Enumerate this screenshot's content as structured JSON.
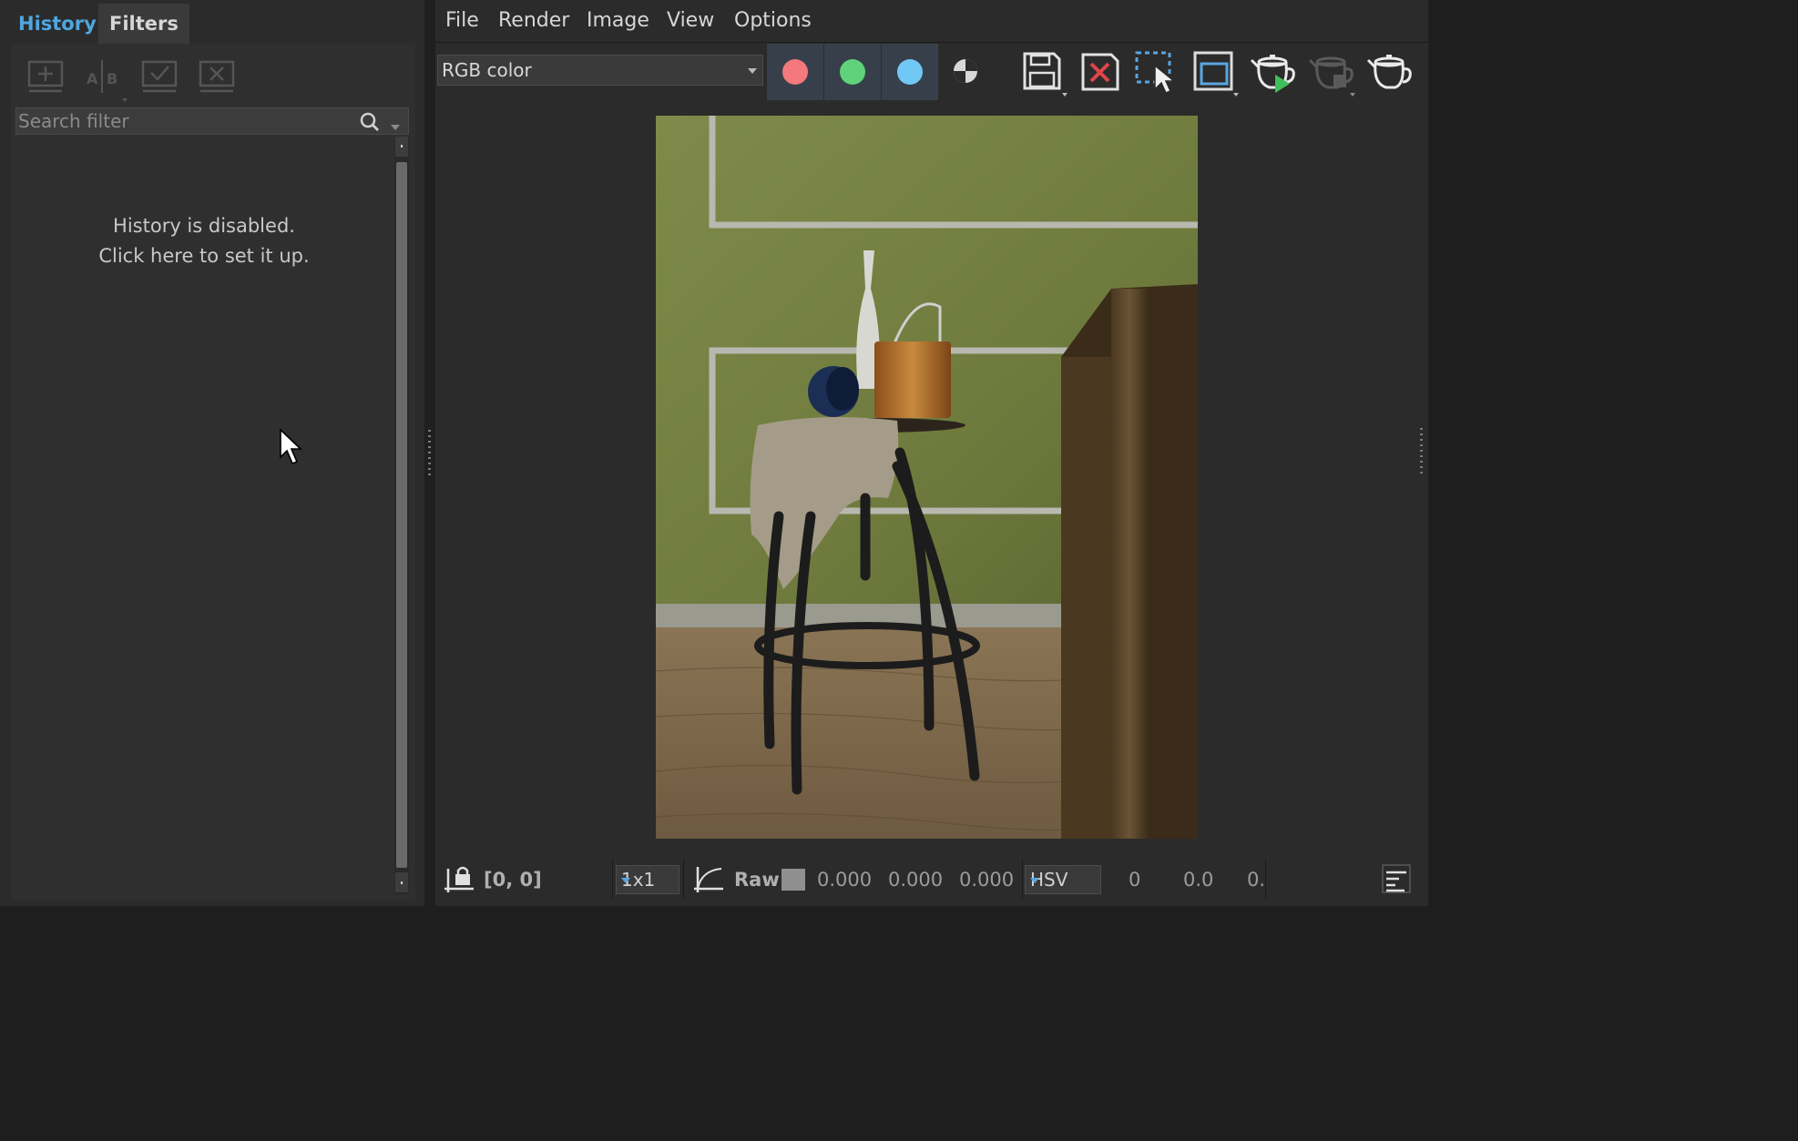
{
  "left_panel": {
    "tabs": [
      {
        "label": "History",
        "active": true
      },
      {
        "label": "Filters",
        "active": false
      }
    ],
    "toolbar_icons": [
      "add-snapshot-icon",
      "ab-compare-icon",
      "apply-snapshot-icon",
      "delete-snapshot-icon"
    ],
    "search": {
      "placeholder": "Search filter",
      "value": ""
    },
    "history_message": {
      "line1": "History is disabled.",
      "line2": "Click here to set it up."
    }
  },
  "menu": {
    "items": [
      "File",
      "Render",
      "Image",
      "View",
      "Options"
    ]
  },
  "toolbar": {
    "channel_combo": {
      "value": "RGB color"
    },
    "channel_buttons": [
      {
        "name": "red-channel",
        "color": "#f4787c"
      },
      {
        "name": "green-channel",
        "color": "#5fd27a"
      },
      {
        "name": "blue-channel",
        "color": "#71c8f5"
      }
    ],
    "icons": [
      "alpha-channel-icon",
      "save-icon",
      "clear-icon",
      "region-select-icon",
      "region-icon",
      "render-start-icon",
      "render-stop-icon",
      "teapot-icon"
    ]
  },
  "statusbar": {
    "coords": "[0, 0]",
    "sample_size": "1x1",
    "mode": "Raw",
    "rgb_values": [
      "0.000",
      "0.000",
      "0.000"
    ],
    "color_space": "HSV",
    "hsv_values": [
      "0",
      "0.0",
      "0."
    ]
  },
  "colors": {
    "accent": "#4fa6e0",
    "panel": "#2b2b2b",
    "channel_button_bg": "#37404a"
  }
}
